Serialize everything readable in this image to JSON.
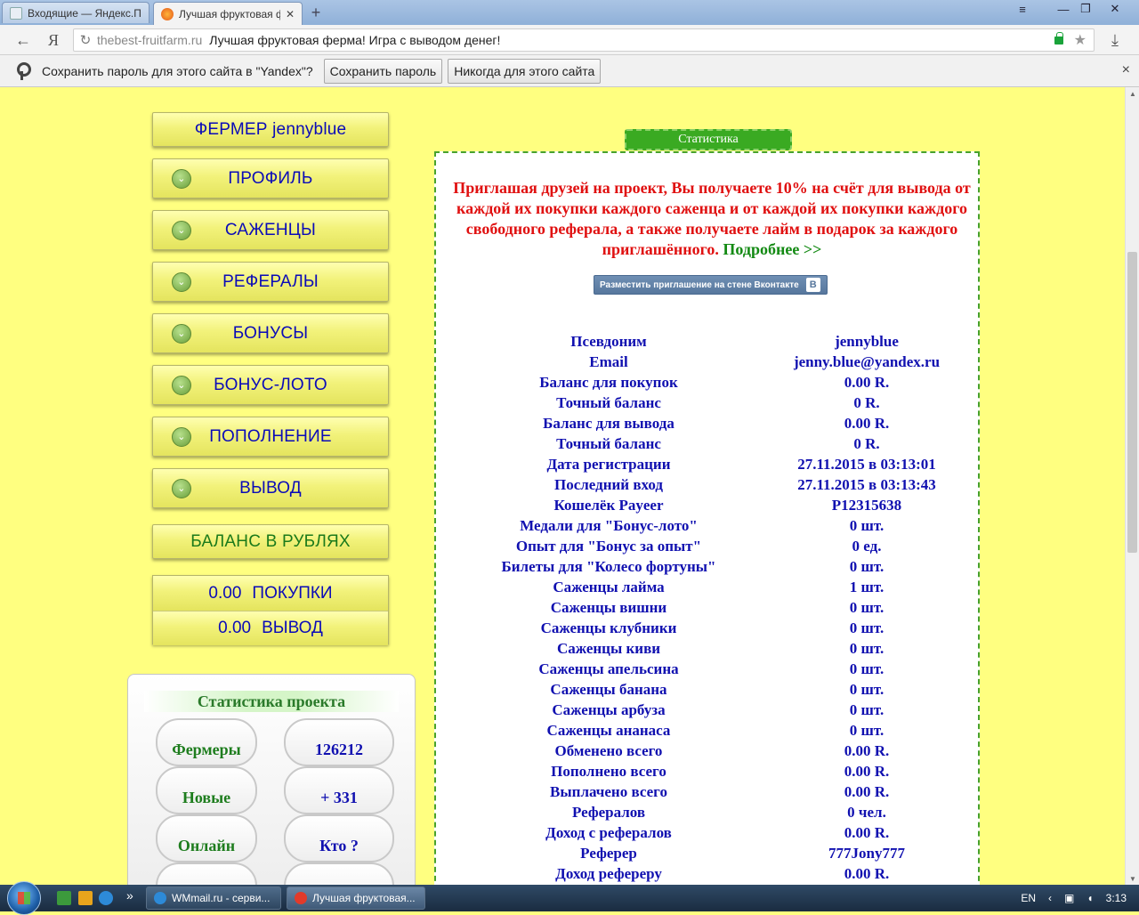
{
  "browser": {
    "tabs": [
      {
        "title": "Входящие — Яндекс.Почта",
        "active": false
      },
      {
        "title": "Лучшая фруктовая ферма",
        "active": true
      }
    ],
    "new_tab": "+",
    "address": {
      "domain": "thebest-fruitfarm.ru",
      "page_title": "Лучшая фруктовая ферма! Игра с выводом денег!"
    },
    "nav": {
      "back": "←",
      "yandex": "Я",
      "reload": "↻",
      "star": "★",
      "download": "⤓"
    },
    "window": {
      "menu": "≡",
      "min": "—",
      "max": "❐",
      "close": "✕"
    },
    "password_bar": {
      "message": "Сохранить пароль для этого сайта в \"Yandex\"?",
      "save": "Сохранить пароль",
      "never": "Никогда для этого сайта",
      "close": "×"
    }
  },
  "sidebar": {
    "farmer_label": "ФЕРМЕР  jennyblue",
    "menu": [
      "ПРОФИЛЬ",
      "САЖЕНЦЫ",
      "РЕФЕРАЛЫ",
      "БОНУСЫ",
      "БОНУС-ЛОТО",
      "ПОПОЛНЕНИЕ",
      "ВЫВОД"
    ],
    "balance_title": "БАЛАНС В РУБЛЯХ",
    "balance_purchases": {
      "value": "0.00",
      "label": "ПОКУПКИ"
    },
    "balance_withdraw": {
      "value": "0.00",
      "label": "ВЫВОД"
    }
  },
  "project_stats": {
    "title": "Статистика проекта",
    "farmers_label": "Фермеры",
    "farmers_value": "126212",
    "new_label": "Новые",
    "new_value": "+ 331",
    "online_label": "Онлайн",
    "online_value": "Кто ?"
  },
  "main": {
    "tab_label": "Статистика",
    "invite_text": "Приглашая друзей на проект, Вы получаете 10% на счёт для вывода от каждой их покупки каждого саженца и от каждой их покупки каждого свободного реферала, а также получаете лайм в подарок за каждого приглашённого.",
    "more_link": "Подробнее >>",
    "vk_button": "Разместить приглашение на стене Вконтакте",
    "vk_letter": "B",
    "rows": [
      {
        "label": "Псевдоним",
        "value": "jennyblue"
      },
      {
        "label": "Email",
        "value": "jenny.blue@yandex.ru"
      },
      {
        "label": "Баланс для покупок",
        "value": "0.00 R."
      },
      {
        "label": "Точный баланс",
        "value": "0 R."
      },
      {
        "label": "Баланс для вывода",
        "value": "0.00 R."
      },
      {
        "label": "Точный баланс",
        "value": "0 R."
      },
      {
        "label": "Дата регистрации",
        "value": "27.11.2015 в 03:13:01"
      },
      {
        "label": "Последний вход",
        "value": "27.11.2015 в 03:13:43"
      },
      {
        "label": "Кошелёк Payeer",
        "value": "P12315638"
      },
      {
        "label": "Медали для \"Бонус-лото\"",
        "value": "0 шт."
      },
      {
        "label": "Опыт для \"Бонус за опыт\"",
        "value": "0 ед."
      },
      {
        "label": "Билеты для \"Колесо фортуны\"",
        "value": "0 шт."
      },
      {
        "label": "Саженцы лайма",
        "value": "1 шт."
      },
      {
        "label": "Саженцы вишни",
        "value": "0 шт."
      },
      {
        "label": "Саженцы клубники",
        "value": "0 шт."
      },
      {
        "label": "Саженцы киви",
        "value": "0 шт."
      },
      {
        "label": "Саженцы апельсина",
        "value": "0 шт."
      },
      {
        "label": "Саженцы банана",
        "value": "0 шт."
      },
      {
        "label": "Саженцы арбуза",
        "value": "0 шт."
      },
      {
        "label": "Саженцы ананаса",
        "value": "0 шт."
      },
      {
        "label": "Обменено всего",
        "value": "0.00 R."
      },
      {
        "label": "Пополнено всего",
        "value": "0.00 R."
      },
      {
        "label": "Выплачено всего",
        "value": "0.00 R."
      },
      {
        "label": "Рефералов",
        "value": "0 чел."
      },
      {
        "label": "Доход с рефералов",
        "value": "0.00 R."
      },
      {
        "label": "Реферер",
        "value": "777Jony777"
      },
      {
        "label": "Доход рефереру",
        "value": "0.00 R."
      }
    ]
  },
  "taskbar": {
    "tasks": [
      "WMmail.ru - серви...",
      "Лучшая фруктовая..."
    ],
    "lang": "EN",
    "clock": "3:13",
    "chevron": "»"
  }
}
